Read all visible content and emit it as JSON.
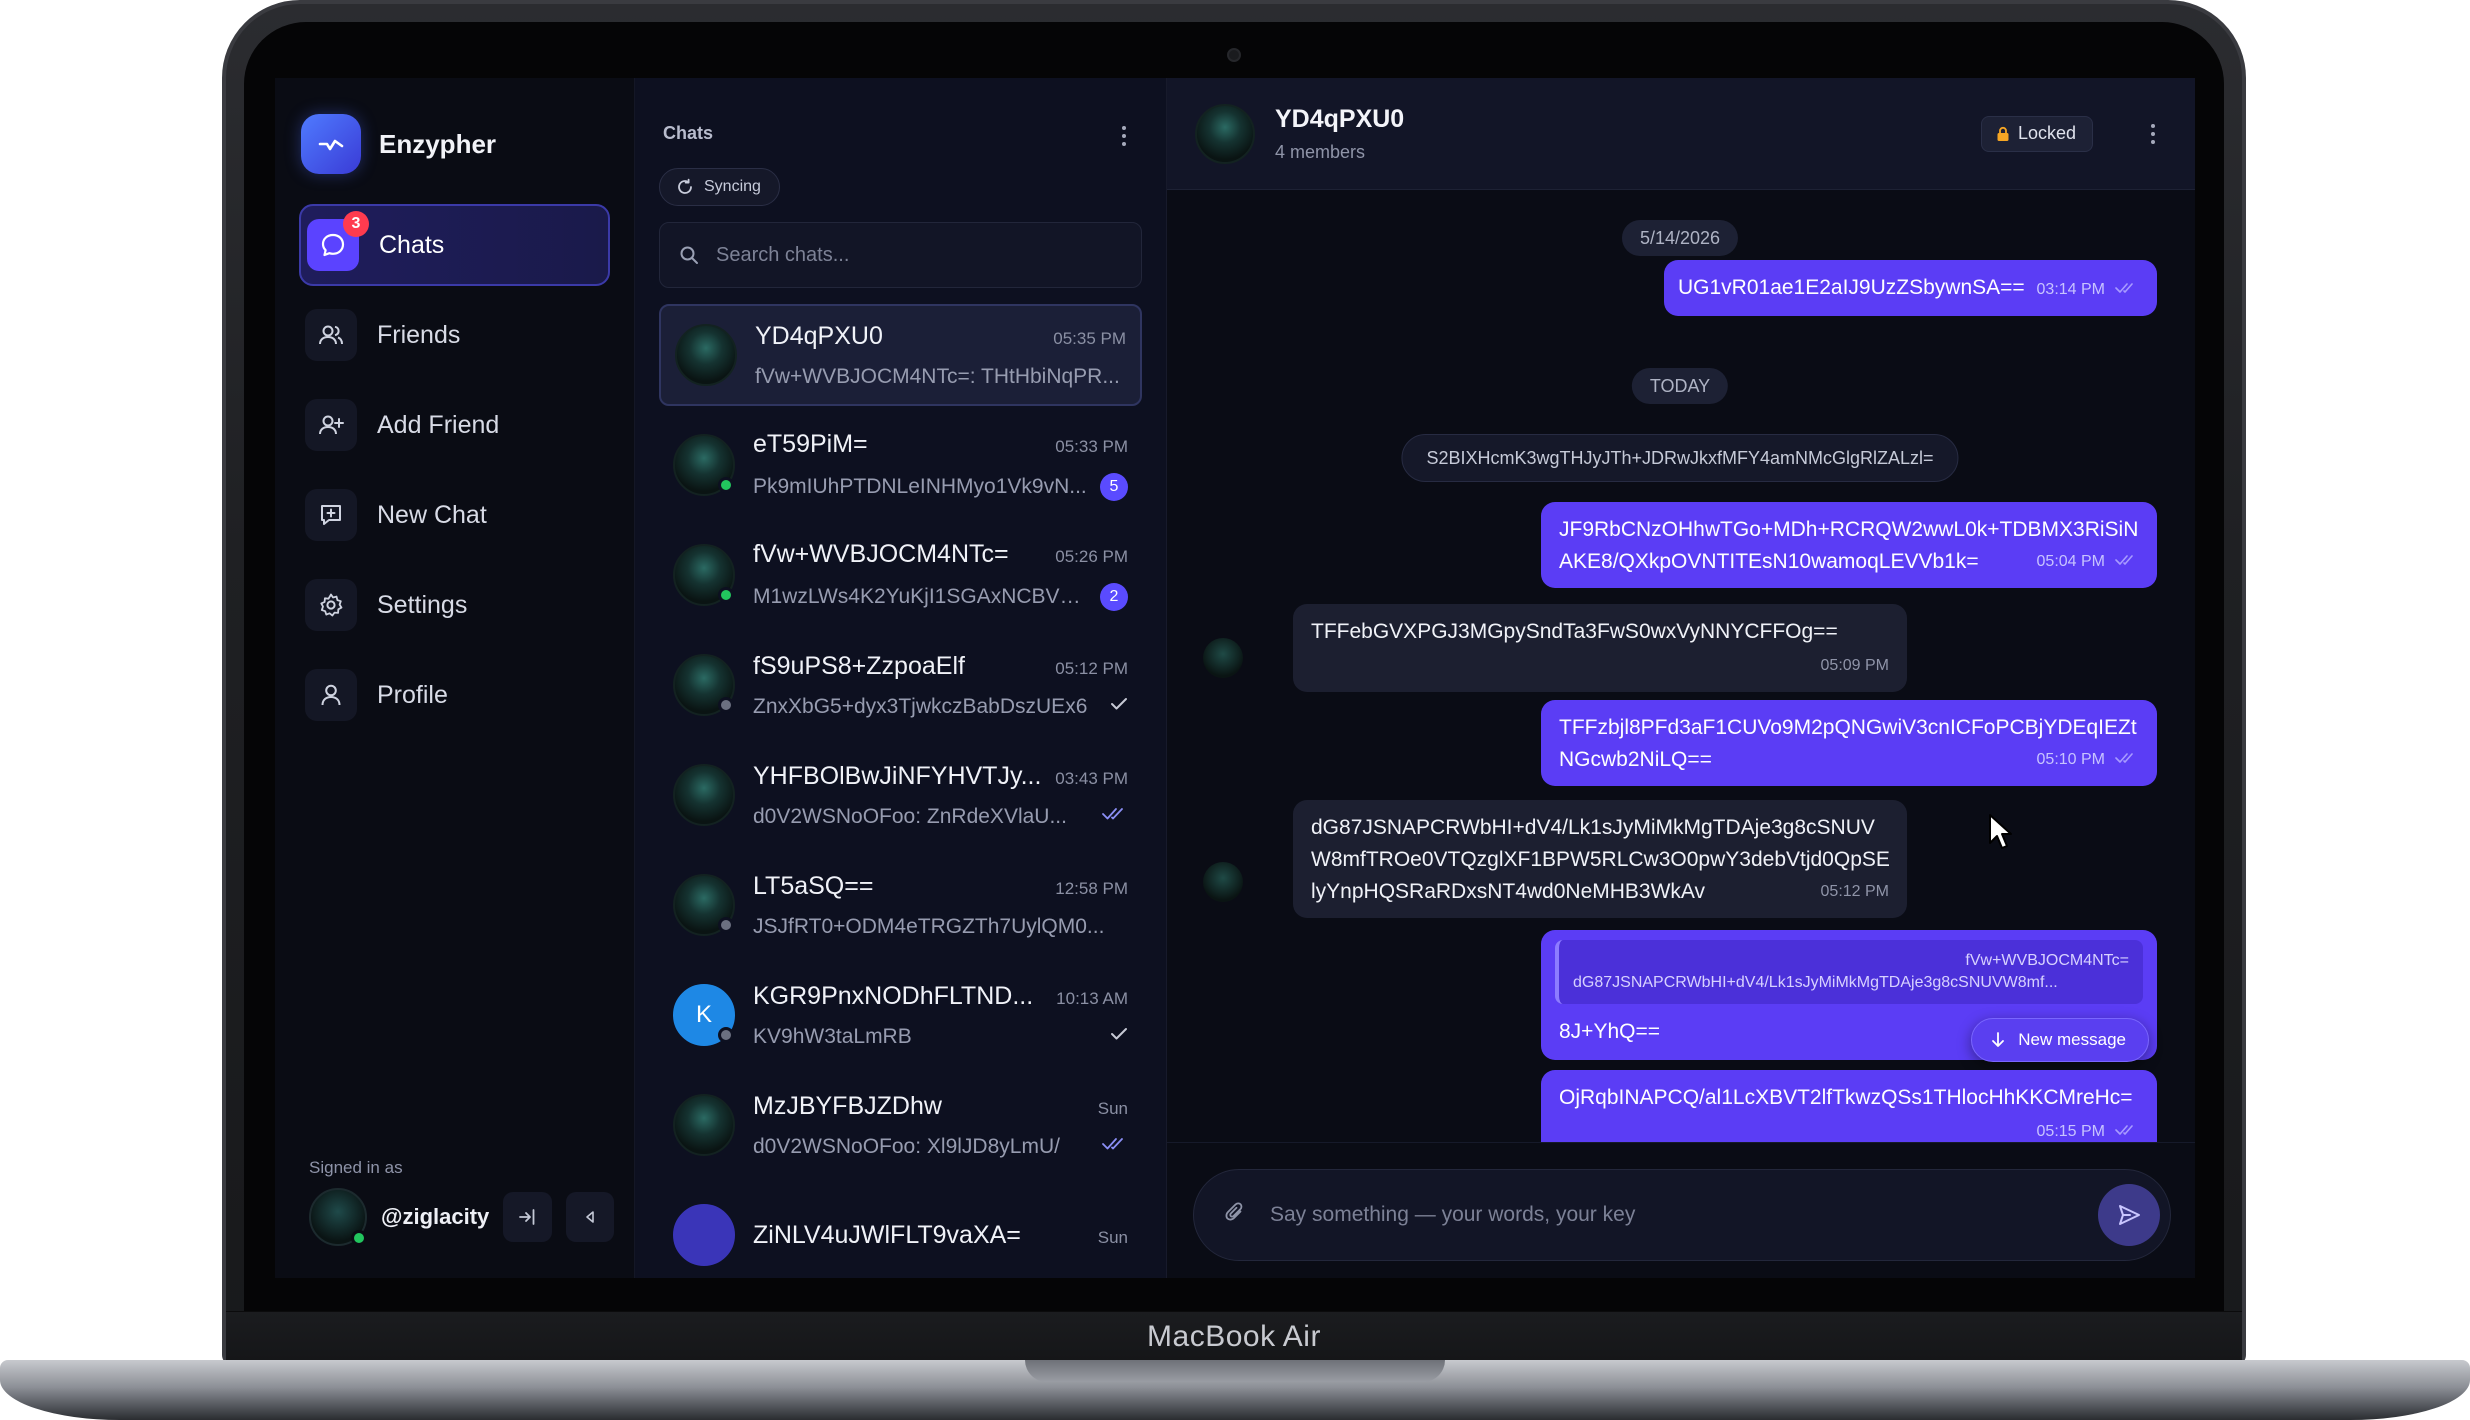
{
  "device": {
    "label": "MacBook Air"
  },
  "brand": {
    "name": "Enzypher"
  },
  "nav": [
    {
      "id": "chats",
      "label": "Chats",
      "icon": "message-bubble-icon",
      "badge": "3",
      "active": true
    },
    {
      "id": "friends",
      "label": "Friends",
      "icon": "users-icon"
    },
    {
      "id": "add-friend",
      "label": "Add Friend",
      "icon": "user-plus-icon"
    },
    {
      "id": "new-chat",
      "label": "New Chat",
      "icon": "message-plus-icon"
    },
    {
      "id": "settings",
      "label": "Settings",
      "icon": "gear-icon"
    },
    {
      "id": "profile",
      "label": "Profile",
      "icon": "user-icon"
    }
  ],
  "account": {
    "signed_label": "Signed in as",
    "username": "@ziglacity"
  },
  "chatlist": {
    "title": "Chats",
    "sync_label": "Syncing",
    "search_placeholder": "Search chats...",
    "items": [
      {
        "name": "YD4qPXU0",
        "time": "05:35 PM",
        "preview": "fVw+WVBJOCM4NTc=: THtHbiNqPR...",
        "selected": true,
        "avatar": "image",
        "status": "none",
        "indicator": "none"
      },
      {
        "name": "eT59PiM=",
        "time": "05:33 PM",
        "preview": "Pk9mIUhPTDNLeINHMyo1Vk9vN...",
        "avatar": "image",
        "status": "online",
        "indicator": "unread",
        "unread": "5"
      },
      {
        "name": "fVw+WVBJOCM4NTc=",
        "time": "05:26 PM",
        "preview": "M1wzLWs4K2YuKjI1SGAxNCBVK...",
        "avatar": "image",
        "status": "online",
        "indicator": "unread",
        "unread": "2"
      },
      {
        "name": "fS9uPS8+ZzpoaElf",
        "time": "05:12 PM",
        "preview": "ZnxXbG5+dyx3TjwkczBabDszUEx6",
        "avatar": "image",
        "status": "offline",
        "indicator": "sent"
      },
      {
        "name": "YHFBOlBwJiNFYHVTJy...",
        "time": "03:43 PM",
        "preview": "d0V2WSNoOFoo: ZnRdeXVlaU...",
        "avatar": "image",
        "status": "none",
        "indicator": "read"
      },
      {
        "name": "LT5aSQ==",
        "time": "12:58 PM",
        "preview": "JSJfRT0+ODM4eTRGZTh7UylQM0...",
        "avatar": "image",
        "status": "offline",
        "indicator": "none"
      },
      {
        "name": "KGR9PnxNODhFLTND...",
        "time": "10:13 AM",
        "preview": "KV9hW3taLmRB",
        "avatar": "initial",
        "initial": "K",
        "status": "offline",
        "indicator": "sent"
      },
      {
        "name": "MzJBYFBJZDhw",
        "time": "Sun",
        "preview": "d0V2WSNoOFoo: Xl9lJD8yLmU/",
        "avatar": "image",
        "status": "none",
        "indicator": "read"
      },
      {
        "name": "ZiNLV4uJWlFLT9vaXA=",
        "time": "Sun",
        "preview": "",
        "avatar": "purple",
        "status": "none",
        "indicator": "none"
      }
    ]
  },
  "conversation": {
    "title": "YD4qPXU0",
    "subtitle": "4 members",
    "lock_label": "Locked",
    "date_pill": "5/14/2026",
    "today_pill": "TODAY",
    "system_message": "S2BIXHcmK3wgTHJyJTh+JDRwJkxfMFY4amNMcGlgRlZALzl=",
    "messages": [
      {
        "dir": "out",
        "text": "UG1vR01ae1E2aIJ9UzZSbywnSA==",
        "time": "03:14 PM"
      },
      {
        "dir": "out",
        "lines": [
          "JF9RbCNzOHhwTGo+MDh+RCRQW2wwL0k+TDBMX3RiSiN",
          "AKE8/QXkpOVNTITEsN10wamoqLEVVb1k="
        ],
        "time": "05:04 PM"
      },
      {
        "dir": "in",
        "text": "TFFebGVXPGJ3MGpySndTa3FwS0wxVyNNYCFFOg==",
        "time": "05:09 PM"
      },
      {
        "dir": "out",
        "lines": [
          "TFFzbjl8PFd3aF1CUVo9M2pQNGwiV3cnICFoPCBjYDEqIEZt",
          "NGcwb2NiLQ=="
        ],
        "time": "05:10 PM"
      },
      {
        "dir": "in",
        "lines": [
          "dG87JSNAPCRWbHI+dV4/Lk1sJyMiMkMgTDAje3g8cSNUV",
          "W8mfTROe0VTQzglXF1BPW5RLCw3O0pwY3debVtjd0QpSE",
          "lyYnpHQSRaRDxsNT4wd0NeMHB3WkAv"
        ],
        "time": "05:12 PM"
      },
      {
        "dir": "out",
        "reply_author": "fVw+WVBJOCM4NTc=",
        "reply_text": "dG87JSNAPCRWbHI+dV4/Lk1sJyMiMkMgTDAje3g8cSNUVW8mf...",
        "text": "8J+YhQ=="
      },
      {
        "dir": "out",
        "text": "OjRqbINAPCQ/al1LcXBVT2lfTkwzQSs1THlocHhKKCMreHc=",
        "time": "05:15 PM"
      }
    ],
    "new_message_label": "New message",
    "composer_placeholder": "Say something — your words, your key"
  },
  "colors": {
    "accent": "#5b3df5",
    "online": "#22c55e",
    "badge": "#ff3b4f"
  }
}
